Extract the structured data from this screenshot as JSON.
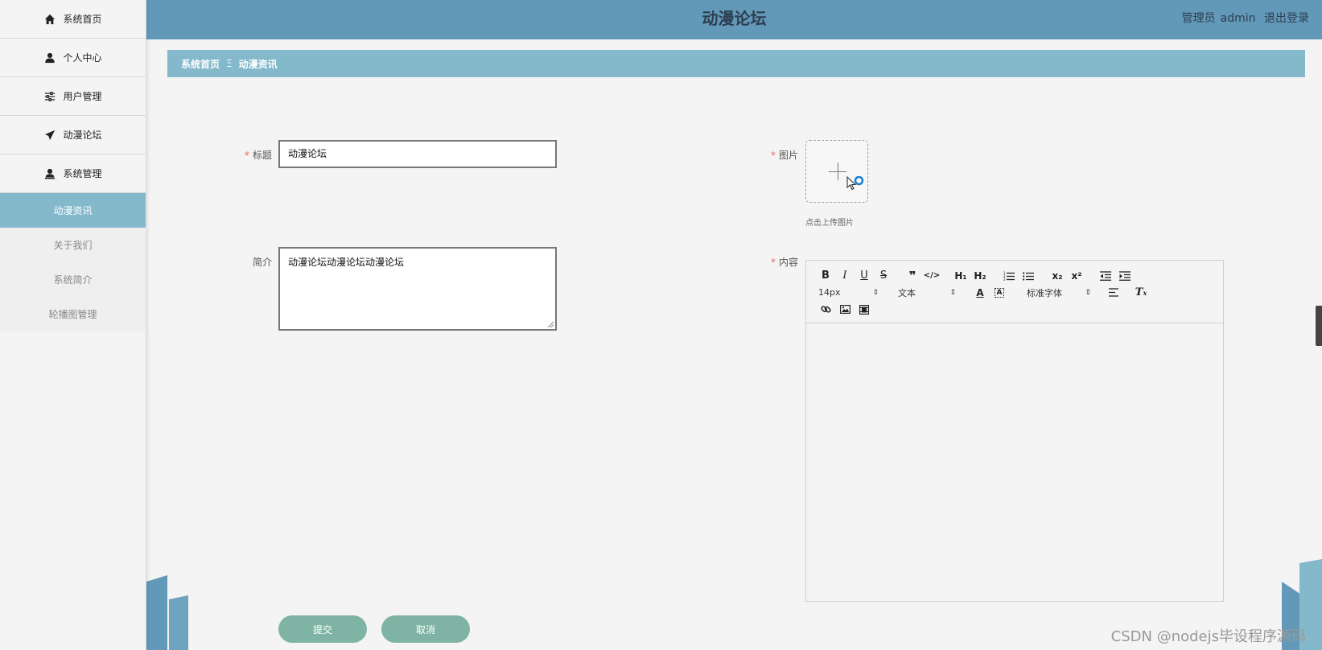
{
  "header": {
    "title": "动漫论坛",
    "role": "管理员",
    "username": "admin",
    "logout_label": "退出登录"
  },
  "sidebar": {
    "items": [
      {
        "label": "系统首页",
        "icon": "home-icon"
      },
      {
        "label": "个人中心",
        "icon": "user-icon"
      },
      {
        "label": "用户管理",
        "icon": "sliders-icon"
      },
      {
        "label": "动漫论坛",
        "icon": "paper-plane-icon"
      },
      {
        "label": "系统管理",
        "icon": "admin-user-icon"
      }
    ],
    "subitems": [
      {
        "label": "动漫资讯"
      },
      {
        "label": "关于我们"
      },
      {
        "label": "系统简介"
      },
      {
        "label": "轮播图管理"
      }
    ],
    "active_subitem": "动漫资讯"
  },
  "breadcrumb": {
    "home": "系统首页",
    "separator": "Ξ",
    "current": "动漫资讯"
  },
  "form": {
    "title_label": "标题",
    "title_value": "动漫论坛",
    "summary_label": "简介",
    "summary_value": "动漫论坛动漫论坛动漫论坛",
    "image_label": "图片",
    "upload_tip": "点击上传图片",
    "content_label": "内容",
    "required_mark": "*"
  },
  "editor": {
    "font_size": "14px",
    "header_select": "文本",
    "font_family": "标准字体"
  },
  "buttons": {
    "submit": "提交",
    "cancel": "取消"
  },
  "watermark": "CSDN @nodejs毕设程序源码",
  "colors": {
    "header_bg": "#6399b8",
    "accent": "#84b8cb",
    "button": "#7fb3a3",
    "required": "#e3695f"
  }
}
